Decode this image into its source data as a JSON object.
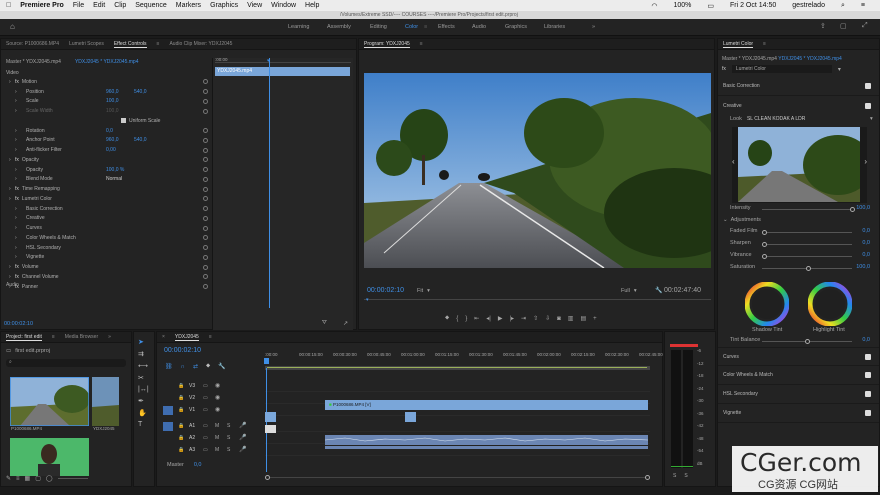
{
  "menubar": {
    "app": "Premiere Pro",
    "items": [
      "File",
      "Edit",
      "Clip",
      "Sequence",
      "Markers",
      "Graphics",
      "View",
      "Window",
      "Help"
    ],
    "status": {
      "battery": "100%",
      "clock": "Fri 2 Oct 14:50",
      "user": "gestrelado"
    }
  },
  "window_title": "/Volumes/Extreme SSD/---- COURSES ----/Premiere Pro/Projects/first edit.prproj",
  "workspaces": [
    "Learning",
    "Assembly",
    "Editing",
    "Color",
    "Effects",
    "Audio",
    "Graphics",
    "Libraries"
  ],
  "workspace_active": "Color",
  "source_tabs": [
    "Source: P1000686.MP4",
    "Lumetri Scopes",
    "Effect Controls",
    "Audio Clip Mixer: YDXJ2045"
  ],
  "effect_controls": {
    "master": "Master * YDXJ2045.mp4",
    "clip": "YDXJ2045 * YDXJ2045.mp4",
    "clip_bar": "YDXJ2045.mp4",
    "sections": {
      "video": "Video",
      "audio": "Audio"
    },
    "rows": [
      {
        "label": "Motion",
        "kind": "fx"
      },
      {
        "label": "Position",
        "v1": "960,0",
        "v2": "540,0"
      },
      {
        "label": "Scale",
        "v1": "100,0"
      },
      {
        "label": "Scale Width",
        "v1": "100,0",
        "dim": true
      },
      {
        "label": "Uniform Scale",
        "kind": "check"
      },
      {
        "label": "Rotation",
        "v1": "0,0"
      },
      {
        "label": "Anchor Point",
        "v1": "960,0",
        "v2": "540,0"
      },
      {
        "label": "Anti-flicker Filter",
        "v1": "0,00"
      },
      {
        "label": "Opacity",
        "kind": "fx"
      },
      {
        "label": "Opacity",
        "v1": "100,0 %"
      },
      {
        "label": "Blend Mode",
        "v1": "Normal"
      },
      {
        "label": "Time Remapping",
        "kind": "fx"
      },
      {
        "label": "Lumetri Color",
        "kind": "fx"
      },
      {
        "label": "Basic Correction"
      },
      {
        "label": "Creative"
      },
      {
        "label": "Curves"
      },
      {
        "label": "Color Wheels & Match"
      },
      {
        "label": "HSL Secondary"
      },
      {
        "label": "Vignette"
      },
      {
        "label": "Volume",
        "kind": "fx"
      },
      {
        "label": "Channel Volume",
        "kind": "fx"
      },
      {
        "label": "Panner",
        "kind": "fx"
      }
    ],
    "timecode": "00:00:02:10"
  },
  "program": {
    "title": "Program: YDXJ2045",
    "timecode": "00:00:02:10",
    "fit": "Fit",
    "quality": "Full",
    "duration": "00:02:47:40"
  },
  "project": {
    "tabs": [
      "Project: first edit",
      "Media Browser"
    ],
    "file": "first edit.prproj",
    "items": [
      "P1000686.MP4",
      "YDXJ2045",
      "",
      ""
    ]
  },
  "timeline": {
    "seq": "YDXJ2045",
    "timecode": "00:00:02:10",
    "ruler": [
      ":00:00",
      "00:00:15:00",
      "00:00:30:00",
      "00:00:45:00",
      "00:01:00:00",
      "00:01:15:00",
      "00:01:30:00",
      "00:01:45:00",
      "00:02:00:00",
      "00:02:15:00",
      "00:02:30:00",
      "00:02:45:00"
    ],
    "tracks": [
      "V3",
      "V2",
      "V1",
      "A1",
      "A2",
      "A3"
    ],
    "master": "Master",
    "master_val": "0,0",
    "clip_label": "P1000686.MP4 [V]"
  },
  "meter": {
    "labels": [
      "-6",
      "-12",
      "-18",
      "-24",
      "-30",
      "-36",
      "-42",
      "-48",
      "-54",
      "dB"
    ],
    "bottom": [
      "S",
      "S"
    ]
  },
  "lumetri": {
    "tab": "Lumetri Color",
    "master": "Master * YDXJ2045.mp4",
    "clip": "YDXJ2045 * YDXJ2045.mp4",
    "effect": "Lumetri Color",
    "basic": "Basic Correction",
    "creative": "Creative",
    "look_label": "Look",
    "look": "SL CLEAN KODAK A LDR",
    "intensity_label": "Intensity",
    "intensity": "100,0",
    "adjustments": "Adjustments",
    "sliders": [
      {
        "label": "Faded Film",
        "value": "0,0",
        "level": 0
      },
      {
        "label": "Sharpen",
        "value": "0,0",
        "level": 0
      },
      {
        "label": "Vibrance",
        "value": "0,0",
        "level": 0
      },
      {
        "label": "Saturation",
        "value": "100,0",
        "level": 0.5
      }
    ],
    "shadow_tint": "Shadow Tint",
    "highlight_tint": "Highlight Tint",
    "tint_balance": "Tint Balance",
    "tint_value": "0,0",
    "sections": [
      "Curves",
      "Color Wheels & Match",
      "HSL Secondary",
      "Vignette"
    ]
  },
  "watermark": {
    "big": "CGer.com",
    "small": "CG资源  CG网站"
  },
  "colors": {
    "accent": "#3f8fe6",
    "clip_video": "#6d8fbd",
    "clip_audio": "#6b86b4",
    "meter_red": "#d33"
  }
}
